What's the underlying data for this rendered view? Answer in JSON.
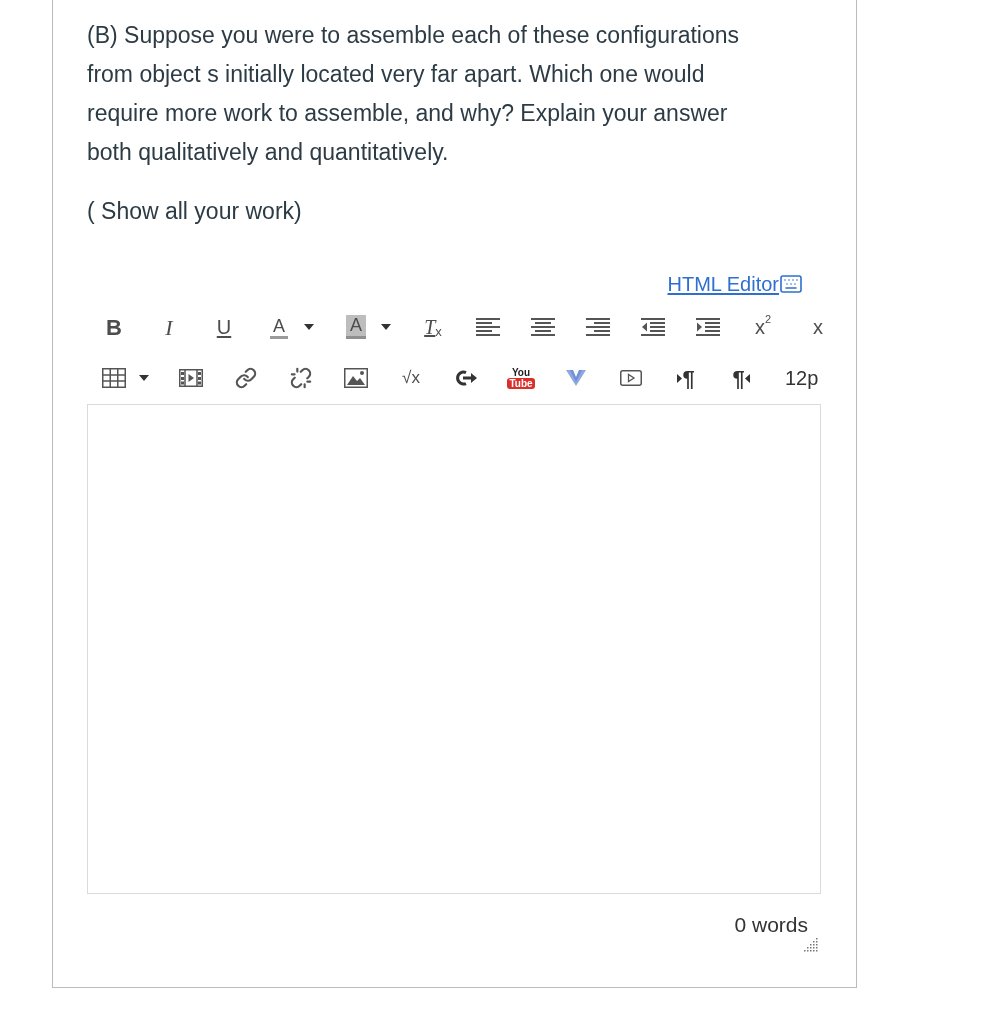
{
  "question": {
    "paragraphs": [
      "(B) Suppose you were to assemble each of these configurations from object s initially located very far apart. Which one would require more work to assemble, and why? Explain your answer both qualitatively and quantitatively.",
      "( Show all your work)"
    ]
  },
  "editor": {
    "html_editor_link": "HTML Editor",
    "toolbar_rows": [
      [
        {
          "kind": "bold",
          "label": "B"
        },
        {
          "kind": "italic",
          "label": "I"
        },
        {
          "kind": "underline",
          "label": "U"
        },
        {
          "kind": "color",
          "label": "A",
          "menu": true
        },
        {
          "kind": "highlight",
          "label": "A",
          "menu": true
        },
        {
          "kind": "clear",
          "label": "T",
          "sub": "x"
        },
        {
          "kind": "alignleft"
        },
        {
          "kind": "aligncenter"
        },
        {
          "kind": "alignright"
        },
        {
          "kind": "outdent"
        },
        {
          "kind": "indent"
        },
        {
          "kind": "superscript",
          "label": "x",
          "sup": "2"
        },
        {
          "kind": "subscript",
          "label": "x"
        }
      ],
      [
        {
          "kind": "table",
          "menu": true
        },
        {
          "kind": "media"
        },
        {
          "kind": "link"
        },
        {
          "kind": "unlink"
        },
        {
          "kind": "image"
        },
        {
          "kind": "equation",
          "label": "√x"
        },
        {
          "kind": "tool"
        },
        {
          "kind": "youtube",
          "label": "You",
          "badge": "Tube"
        },
        {
          "kind": "vmark"
        },
        {
          "kind": "embed"
        },
        {
          "kind": "ltr",
          "label": "¶"
        },
        {
          "kind": "rtl",
          "label": "¶"
        },
        {
          "kind": "fontsize",
          "label": "12p"
        }
      ]
    ],
    "word_count": "0 words"
  }
}
